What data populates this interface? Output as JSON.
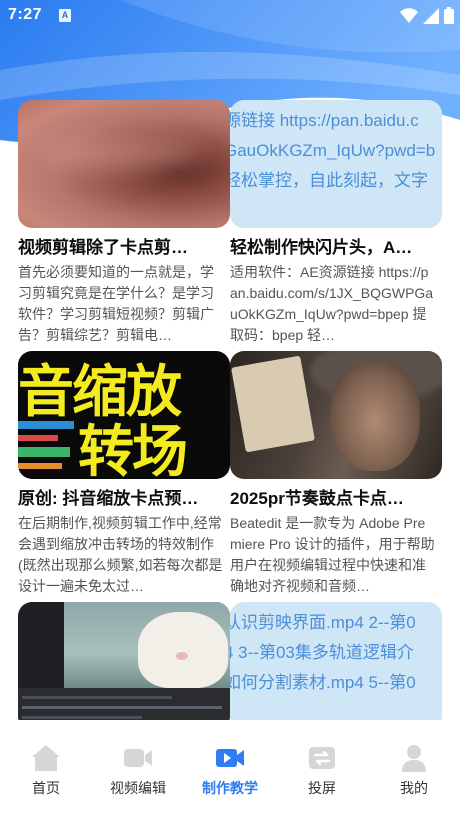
{
  "status_bar": {
    "time": "7:27",
    "notification_badge": "A",
    "icons": [
      "wifi-icon",
      "signal-icon",
      "battery-icon"
    ]
  },
  "theme": {
    "accent": "#2f7df0",
    "header_gradient": [
      "#2a7bf0",
      "#6fb0ff"
    ],
    "tab_inactive": "#d6d6d6"
  },
  "cards": [
    {
      "title": "视频剪辑除了卡点剪…",
      "description": "首先必须要知道的一点就是，学习剪辑究竟是在学什么？是学习软件？学习剪辑短视频？剪辑广告？剪辑综艺？剪辑电…",
      "thumbnail": "blurred-photo"
    },
    {
      "title": "轻松制作快闪片头，A…",
      "description": "适用软件：AE资源链接 https://pan.baidu.com/s/1JX_BQGWPGauOkKGZm_IqUw?pwd=bpep 提取码：bpep 轻…",
      "thumbnail": "link-text",
      "thumb_lines": [
        "源链接 https://pan.baidu.c",
        "GauOkKGZm_IqUw?pwd=b",
        "轻松掌控，自此刻起，文字"
      ]
    },
    {
      "title": "原创: 抖音缩放卡点预…",
      "description": "在后期制作,视频剪辑工作中,经常会遇到缩放冲击转场的特效制作(既然出现那么频繁,如若每次都是设计一遍未免太过…",
      "thumbnail": "zoom-transition",
      "thumb_lines": [
        "音缩放",
        "转场"
      ]
    },
    {
      "title": "2025pr节奏鼓点卡点…",
      "description": "Beatedit 是一款专为 Adobe Premiere Pro 设计的插件，用于帮助用户在视频编辑过程中快速和准确地对齐视频和音频…",
      "thumbnail": "portrait-photo"
    },
    {
      "title": "",
      "description": "",
      "thumbnail": "editor-screenshot"
    },
    {
      "title": "",
      "description": "",
      "thumbnail": "file-list",
      "thumb_lines": [
        "认识剪映界面.mp4 2--第0",
        "4 3--第03集多轨道逻辑介",
        "如何分割素材.mp4 5--第0"
      ]
    }
  ],
  "tabs": [
    {
      "label": "首页",
      "icon": "home-icon",
      "active": false
    },
    {
      "label": "视频编辑",
      "icon": "video-camera-icon",
      "active": false
    },
    {
      "label": "制作教学",
      "icon": "video-play-icon",
      "active": true
    },
    {
      "label": "投屏",
      "icon": "screen-cast-icon",
      "active": false
    },
    {
      "label": "我的",
      "icon": "user-icon",
      "active": false
    }
  ]
}
